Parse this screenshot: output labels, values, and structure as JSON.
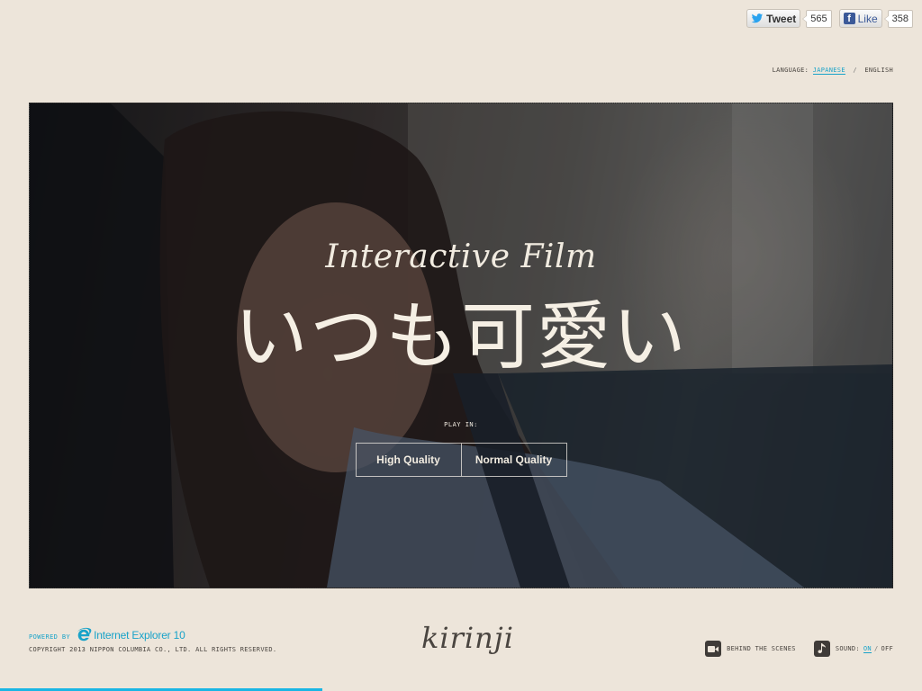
{
  "social": {
    "tweet_label": "Tweet",
    "tweet_count": "565",
    "like_label": "Like",
    "like_count": "358"
  },
  "language": {
    "label": "LANGUAGE:",
    "options": [
      "JAPANESE",
      "ENGLISH"
    ],
    "selected": "JAPANESE"
  },
  "hero": {
    "subtitle": "Interactive Film",
    "title": "いつも可愛い",
    "play_label": "PLAY IN:",
    "quality_options": [
      "High Quality",
      "Normal Quality"
    ]
  },
  "footer": {
    "powered_by": "POWERED BY",
    "browser_name": "Internet Explorer 10",
    "copyright": "COPYRIGHT 2013 NIPPON COLUMBIA CO., LTD. ALL RIGHTS RESERVED.",
    "logo": "kirinji",
    "behind_the_scenes": "BEHIND THE SCENES",
    "sound_label": "SOUND:",
    "sound_on": "ON",
    "sound_off": "OFF"
  },
  "progress": {
    "fraction": 0.35
  },
  "colors": {
    "accent": "#19a3c9",
    "background": "#ede5da",
    "progress": "#19b6e4"
  }
}
